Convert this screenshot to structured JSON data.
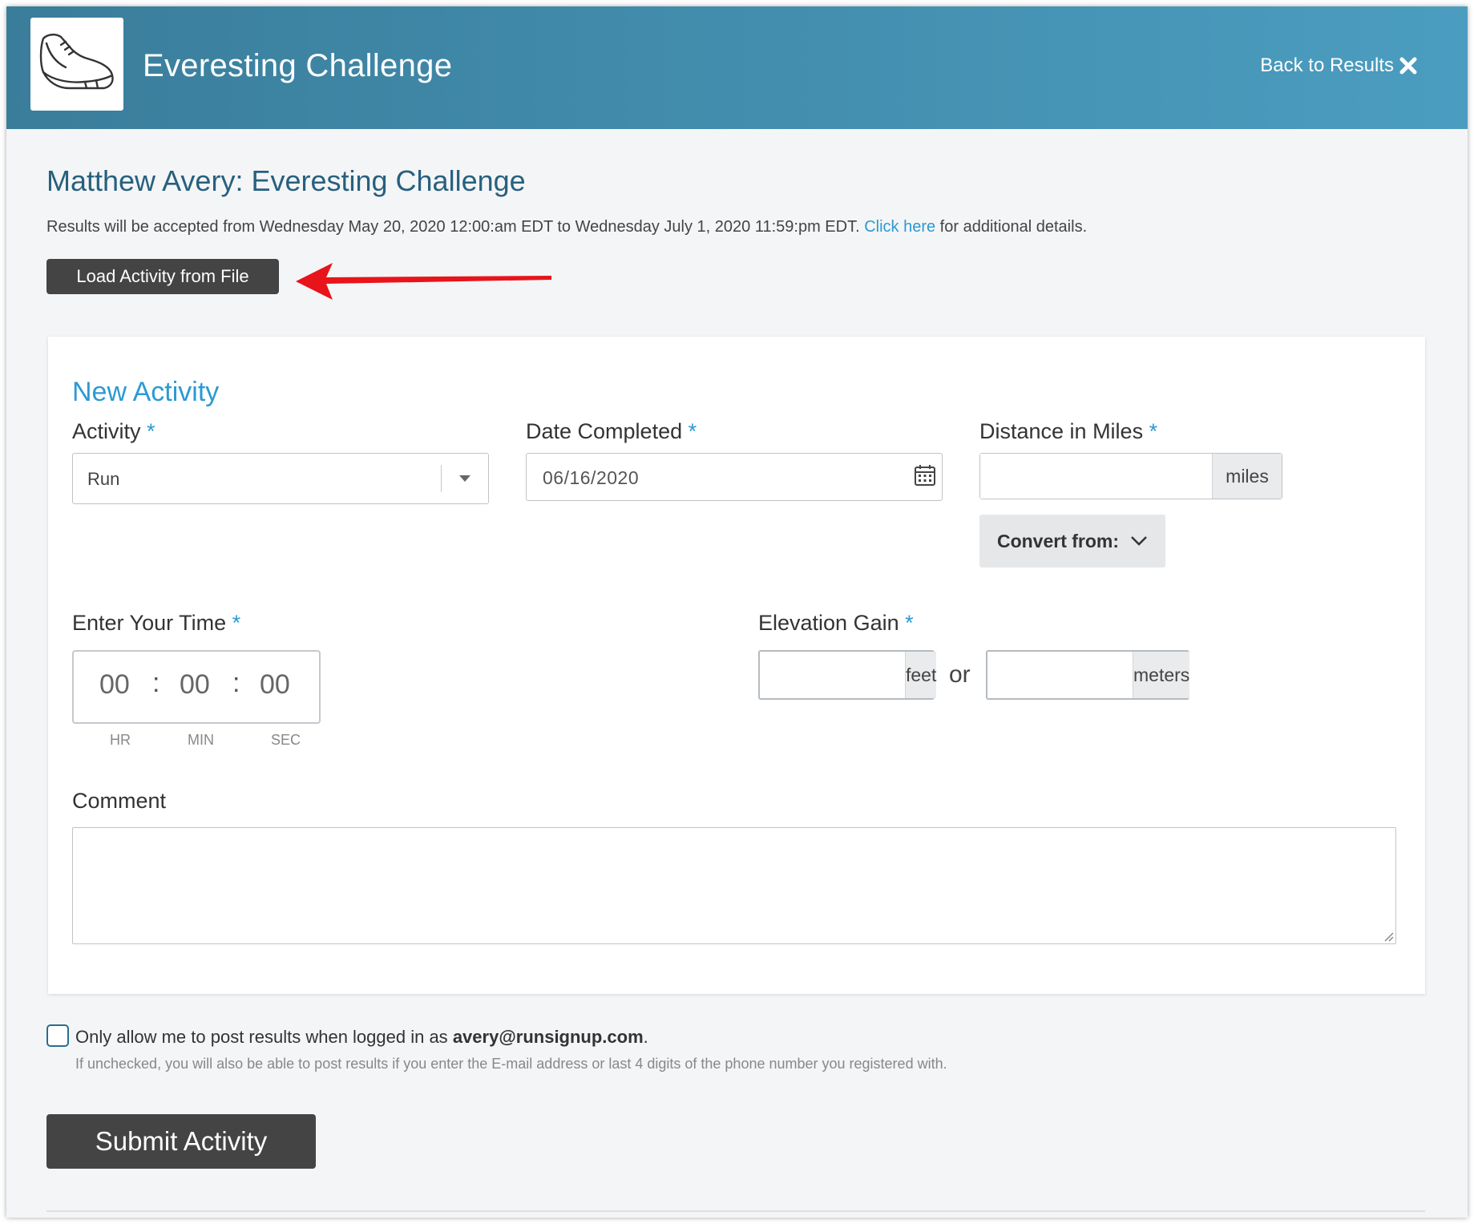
{
  "header": {
    "app_title": "Everesting Challenge",
    "back_label": "Back to Results",
    "logo_icon": "running-shoe-icon",
    "brand_color": "#3a7d9b"
  },
  "page": {
    "title": "Matthew Avery: Everesting Challenge",
    "accept_text_before": "Results will be accepted from Wednesday May 20, 2020 12:00:am EDT to Wednesday July 1, 2020 11:59:pm EDT.",
    "accept_link": "Click here",
    "accept_text_after": "for additional details.",
    "load_button": "Load Activity from File"
  },
  "form": {
    "section_title": "New Activity",
    "required_mark": "*",
    "activity": {
      "label": "Activity",
      "value": "Run"
    },
    "date": {
      "label": "Date Completed",
      "value": "06/16/2020"
    },
    "distance": {
      "label": "Distance in Miles",
      "value": "",
      "unit": "miles",
      "convert_label": "Convert from:"
    },
    "time": {
      "label": "Enter Your Time",
      "hours": "00",
      "minutes": "00",
      "seconds": "00",
      "separator": ":",
      "hr_label": "HR",
      "min_label": "MIN",
      "sec_label": "SEC"
    },
    "elevation": {
      "label": "Elevation Gain",
      "feet_unit": "feet",
      "or_text": "or",
      "meters_unit": "meters"
    },
    "comment": {
      "label": "Comment",
      "value": ""
    }
  },
  "login_restrict": {
    "checked": false,
    "label_before": "Only allow me to post results when logged in as",
    "email": "avery@runsignup.com",
    "label_after": ".",
    "help": "If unchecked, you will also be able to post results if you enter the E-mail address or last 4 digits of the phone number you registered with."
  },
  "submit_label": "Submit Activity",
  "annotation": {
    "arrow_color": "#e8141b"
  }
}
